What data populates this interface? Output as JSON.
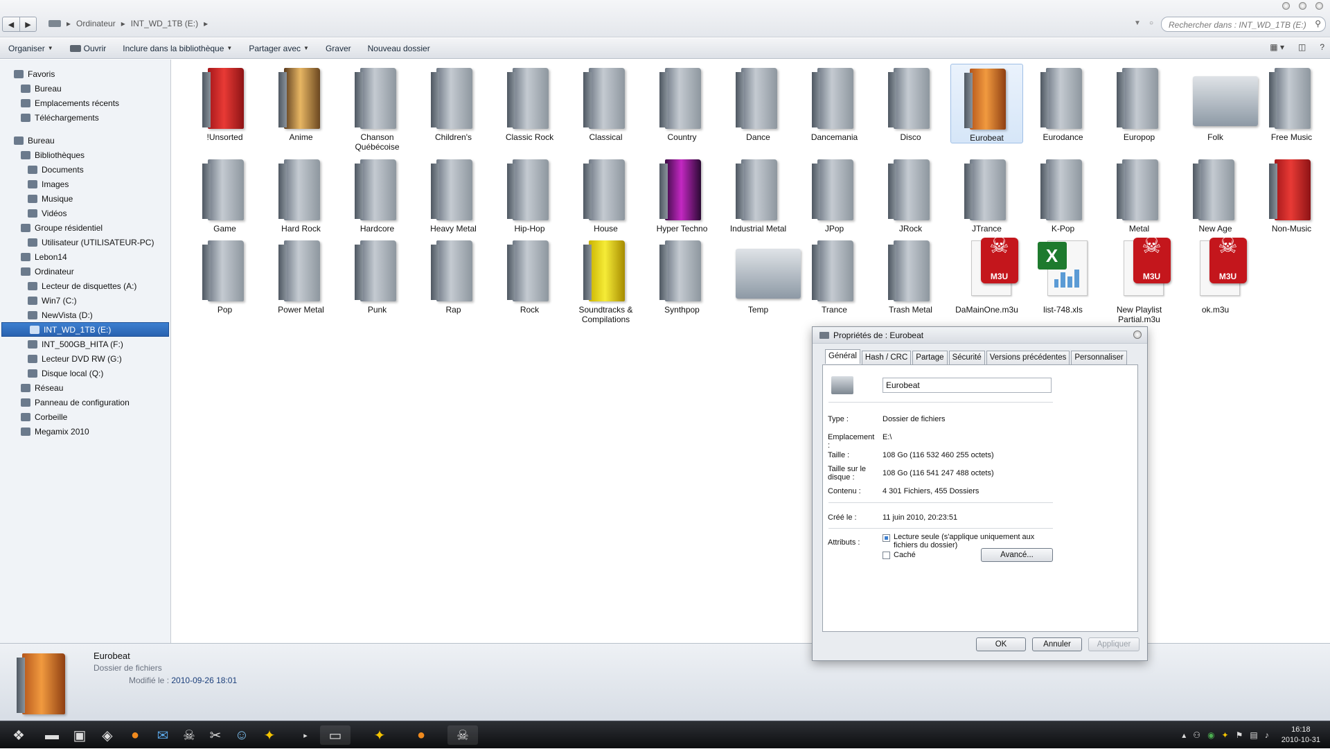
{
  "address": {
    "crumbs": [
      "Ordinateur",
      "INT_WD_1TB (E:)"
    ],
    "search_placeholder": "Rechercher dans : INT_WD_1TB (E:)"
  },
  "toolbar": {
    "organize": "Organiser",
    "open": "Ouvrir",
    "include": "Inclure dans la bibliothèque",
    "share": "Partager avec",
    "burn": "Graver",
    "new_folder": "Nouveau dossier"
  },
  "sidebar": [
    {
      "label": "Favoris",
      "indent": 0
    },
    {
      "label": "Bureau",
      "indent": 1
    },
    {
      "label": "Emplacements récents",
      "indent": 1
    },
    {
      "label": "Téléchargements",
      "indent": 1
    },
    {
      "gap": true
    },
    {
      "label": "Bureau",
      "indent": 0
    },
    {
      "label": "Bibliothèques",
      "indent": 1
    },
    {
      "label": "Documents",
      "indent": 2
    },
    {
      "label": "Images",
      "indent": 2
    },
    {
      "label": "Musique",
      "indent": 2
    },
    {
      "label": "Vidéos",
      "indent": 2
    },
    {
      "label": "Groupe résidentiel",
      "indent": 1
    },
    {
      "label": "Utilisateur (UTILISATEUR-PC)",
      "indent": 2
    },
    {
      "label": "Lebon14",
      "indent": 1
    },
    {
      "label": "Ordinateur",
      "indent": 1
    },
    {
      "label": "Lecteur de disquettes (A:)",
      "indent": 2
    },
    {
      "label": "Win7 (C:)",
      "indent": 2
    },
    {
      "label": "NewVista (D:)",
      "indent": 2
    },
    {
      "label": "INT_WD_1TB (E:)",
      "indent": 2,
      "selected": true
    },
    {
      "label": "INT_500GB_HITA (F:)",
      "indent": 2
    },
    {
      "label": "Lecteur DVD RW (G:)",
      "indent": 2
    },
    {
      "label": "Disque local (Q:)",
      "indent": 2
    },
    {
      "label": "Réseau",
      "indent": 1
    },
    {
      "label": "Panneau de configuration",
      "indent": 1
    },
    {
      "label": "Corbeille",
      "indent": 1
    },
    {
      "label": "Megamix 2010",
      "indent": 1
    }
  ],
  "items": [
    {
      "label": "!Unsorted",
      "style": "red"
    },
    {
      "label": "Anime",
      "style": "photo"
    },
    {
      "label": "Chanson Québécoise",
      "style": "gray"
    },
    {
      "label": "Children's",
      "style": "gray"
    },
    {
      "label": "Classic Rock",
      "style": "gray"
    },
    {
      "label": "Classical",
      "style": "gray"
    },
    {
      "label": "Country",
      "style": "gray"
    },
    {
      "label": "Dance",
      "style": "gray"
    },
    {
      "label": "Dancemania",
      "style": "gray"
    },
    {
      "label": "Disco",
      "style": "gray"
    },
    {
      "label": "Eurobeat",
      "style": "orange",
      "selected": true
    },
    {
      "label": "Eurodance",
      "style": "gray"
    },
    {
      "label": "Europop",
      "style": "gray"
    },
    {
      "label": "Folk",
      "style": "wide"
    },
    {
      "label": "Free Music",
      "style": "gray"
    },
    {
      "label": "Game",
      "style": "gray"
    },
    {
      "label": "Hard Rock",
      "style": "gray"
    },
    {
      "label": "Hardcore",
      "style": "gray"
    },
    {
      "label": "Heavy Metal",
      "style": "gray"
    },
    {
      "label": "Hip-Hop",
      "style": "gray"
    },
    {
      "label": "House",
      "style": "gray"
    },
    {
      "label": "Hyper Techno",
      "style": "purple"
    },
    {
      "label": "Industrial Metal",
      "style": "gray"
    },
    {
      "label": "JPop",
      "style": "gray"
    },
    {
      "label": "JRock",
      "style": "gray"
    },
    {
      "label": "JTrance",
      "style": "gray"
    },
    {
      "label": "K-Pop",
      "style": "gray"
    },
    {
      "label": "Metal",
      "style": "gray"
    },
    {
      "label": "New Age",
      "style": "gray"
    },
    {
      "label": "Non-Music",
      "style": "red"
    },
    {
      "label": "Pop",
      "style": "gray"
    },
    {
      "label": "Power Metal",
      "style": "gray"
    },
    {
      "label": "Punk",
      "style": "gray"
    },
    {
      "label": "Rap",
      "style": "gray"
    },
    {
      "label": "Rock",
      "style": "gray"
    },
    {
      "label": "Soundtracks & Compilations",
      "style": "yellow"
    },
    {
      "label": "Synthpop",
      "style": "gray"
    },
    {
      "label": "Temp",
      "style": "wide"
    },
    {
      "label": "Trance",
      "style": "gray"
    },
    {
      "label": "Trash Metal",
      "style": "gray"
    },
    {
      "label": "DaMainOne.m3u",
      "style": "m3u"
    },
    {
      "label": "list-748.xls",
      "style": "xls"
    },
    {
      "label": "New Playlist Partial.m3u",
      "style": "m3u"
    },
    {
      "label": "ok.m3u",
      "style": "m3u"
    }
  ],
  "details": {
    "name": "Eurobeat",
    "type": "Dossier de fichiers",
    "modified_label": "Modifié le :",
    "modified_value": "2010-09-26 18:01"
  },
  "dialog": {
    "title": "Propriétés de : Eurobeat",
    "tabs": [
      "Général",
      "Hash / CRC",
      "Partage",
      "Sécurité",
      "Versions précédentes",
      "Personnaliser"
    ],
    "name_value": "Eurobeat",
    "type_label": "Type :",
    "type_value": "Dossier de fichiers",
    "location_label": "Emplacement :",
    "location_value": "E:\\",
    "size_label": "Taille :",
    "size_value": "108 Go (116 532 460 255 octets)",
    "disk_size_label": "Taille sur le disque :",
    "disk_size_value": "108 Go (116 541 247 488 octets)",
    "contents_label": "Contenu :",
    "contents_value": "4 301 Fichiers, 455 Dossiers",
    "created_label": "Créé le :",
    "created_value": "11 juin 2010, 20:23:51",
    "attributes_label": "Attributs :",
    "readonly_label": "Lecture seule (s'applique uniquement aux fichiers du dossier)",
    "hidden_label": "Caché",
    "advanced_label": "Avancé...",
    "ok_label": "OK",
    "cancel_label": "Annuler",
    "apply_label": "Appliquer"
  },
  "taskbar": {
    "time": "16:18",
    "date": "2010-10-31"
  }
}
